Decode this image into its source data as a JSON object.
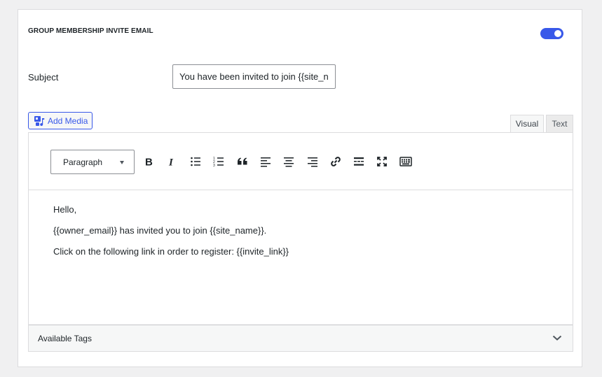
{
  "section": {
    "title": "GROUP MEMBERSHIP INVITE EMAIL",
    "enabled": true
  },
  "subject": {
    "label": "Subject",
    "value": "You have been invited to join {{site_name}}"
  },
  "editor": {
    "add_media_label": "Add Media",
    "tabs": {
      "visual": "Visual",
      "text": "Text"
    },
    "format_select": "Paragraph",
    "toolbar_icons": [
      "bold-icon",
      "italic-icon",
      "bulleted-list-icon",
      "numbered-list-icon",
      "blockquote-icon",
      "align-left-icon",
      "align-center-icon",
      "align-right-icon",
      "link-icon",
      "read-more-icon",
      "fullscreen-icon",
      "toolbar-toggle-icon"
    ],
    "body": [
      "Hello,",
      "{{owner_email}} has invited you to join {{site_name}}.",
      "Click on the following link in order to register: {{invite_link}}"
    ],
    "available_tags_label": "Available Tags"
  },
  "colors": {
    "accent": "#3858e9",
    "border": "#dcdcde",
    "background": "#f0f0f1"
  }
}
